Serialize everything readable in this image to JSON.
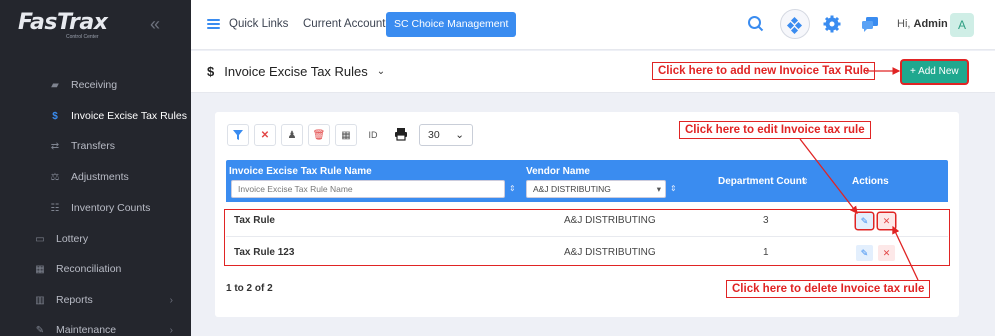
{
  "app": {
    "logo_text": "FasTrax",
    "logo_sub": "Control Center"
  },
  "sidebar": {
    "items": [
      {
        "label": "Receiving",
        "icon": "truck-icon"
      },
      {
        "label": "Invoice Excise Tax Rules",
        "icon": "dollar-icon",
        "active": true
      },
      {
        "label": "Transfers",
        "icon": "arrows-exchange-icon"
      },
      {
        "label": "Adjustments",
        "icon": "scale-icon"
      },
      {
        "label": "Inventory Counts",
        "icon": "checklist-icon"
      },
      {
        "label": "Lottery",
        "icon": "ticket-icon"
      },
      {
        "label": "Reconciliation",
        "icon": "grid-icon"
      },
      {
        "label": "Reports",
        "icon": "bar-chart-icon"
      },
      {
        "label": "Maintenance",
        "icon": "wrench-icon"
      }
    ]
  },
  "topbar": {
    "quick_links": "Quick Links",
    "current_account_label": "Current Account:",
    "current_account_value": "SC Choice Management",
    "greeting": "Hi,",
    "user_name": "Admin",
    "avatar_letter": "A"
  },
  "page": {
    "title": "Invoice Excise Tax Rules",
    "add_new": "+ Add New"
  },
  "toolbar": {
    "id_label": "ID",
    "page_size": "30"
  },
  "grid": {
    "columns": {
      "name": "Invoice Excise Tax Rule Name",
      "vendor": "Vendor Name",
      "dept_count": "Department Count",
      "actions": "Actions"
    },
    "filters": {
      "name_placeholder": "Invoice Excise Tax Rule Name",
      "vendor_selected": "A&J DISTRIBUTING"
    },
    "rows": [
      {
        "name": "Tax Rule",
        "vendor": "A&J DISTRIBUTING",
        "dept_count": "3"
      },
      {
        "name": "Tax Rule 123",
        "vendor": "A&J DISTRIBUTING",
        "dept_count": "1"
      }
    ],
    "pager": "1 to 2 of 2"
  },
  "annotations": {
    "add": "Click here to add new Invoice Tax Rule",
    "edit": "Click here to edit Invoice tax rule",
    "delete": "Click here to delete Invoice tax rule"
  },
  "colors": {
    "accent": "#3a8cf0",
    "sidebar_bg": "#24262d",
    "add_button": "#20a88f",
    "annotation": "#e02424"
  }
}
